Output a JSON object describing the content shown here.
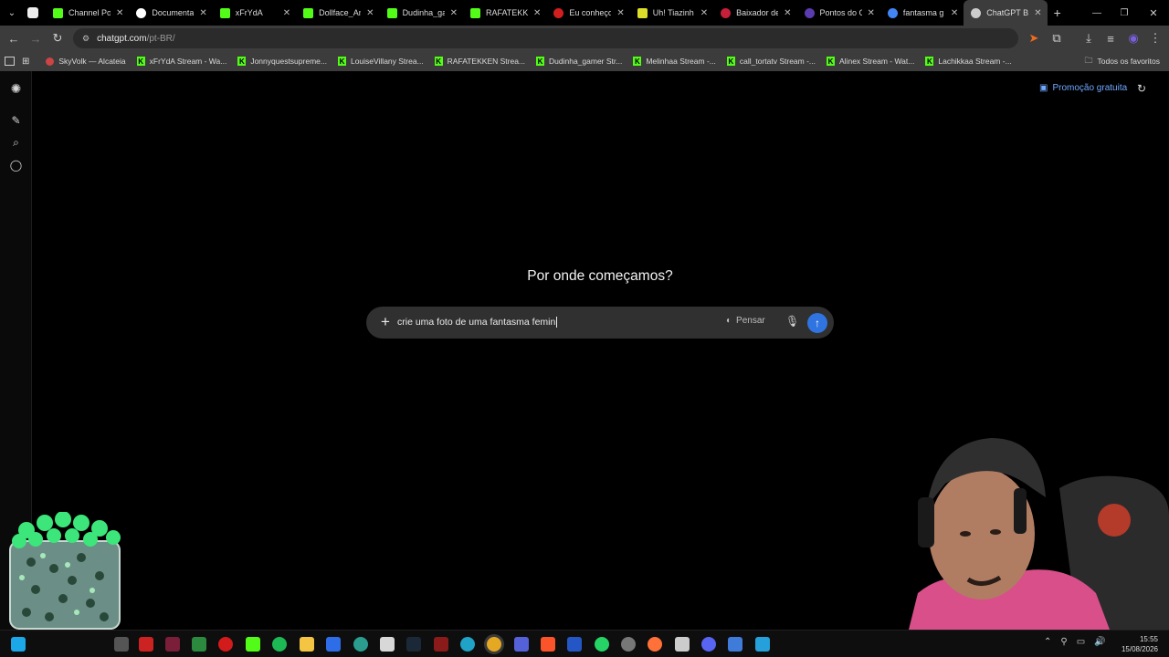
{
  "browser": {
    "tabs": [
      {
        "title": "Channel Po",
        "icon": "kick-icon",
        "color": "#53fc18",
        "active": false
      },
      {
        "title": "Documenta",
        "icon": "github-icon",
        "color": "#ffffff",
        "active": false
      },
      {
        "title": "xFrYdA",
        "icon": "kick-icon",
        "color": "#53fc18",
        "active": false
      },
      {
        "title": "Dollface_An",
        "icon": "kick-icon",
        "color": "#53fc18",
        "active": false
      },
      {
        "title": "Dudinha_ga",
        "icon": "kick-icon",
        "color": "#53fc18",
        "active": false
      },
      {
        "title": "RAFATEKKE",
        "icon": "kick-icon",
        "color": "#53fc18",
        "active": false
      },
      {
        "title": "Eu conheço",
        "icon": "red-circle-icon",
        "color": "#d11f1f",
        "active": false
      },
      {
        "title": "Uh! Tiazinh",
        "icon": "yellow-square-icon",
        "color": "#dede2a",
        "active": false
      },
      {
        "title": "Baixador de",
        "icon": "red-circle-icon",
        "color": "#c51f3a",
        "active": false
      },
      {
        "title": "Pontos do C",
        "icon": "purple-circle-icon",
        "color": "#5b3bb0",
        "active": false
      },
      {
        "title": "fantasma g",
        "icon": "google-icon",
        "color": "#4285f4",
        "active": false
      },
      {
        "title": "ChatGPT Br",
        "icon": "chatgpt-icon",
        "color": "#cccccc",
        "active": true
      }
    ],
    "address": {
      "host": "chatgpt.com",
      "path": "/pt-BR/"
    },
    "bookmarks": [
      {
        "label": "SkyVolk — Alcateia",
        "icon": "wolf-icon"
      },
      {
        "label": "xFrYdA Stream - Wa...",
        "icon": "kick-icon"
      },
      {
        "label": "Jonnyquestsupreme...",
        "icon": "kick-icon"
      },
      {
        "label": "LouiseVillany Strea...",
        "icon": "kick-icon"
      },
      {
        "label": "RAFATEKKEN Strea...",
        "icon": "kick-icon"
      },
      {
        "label": "Dudinha_gamer Str...",
        "icon": "kick-icon"
      },
      {
        "label": "Melinhaa Stream -...",
        "icon": "kick-icon"
      },
      {
        "label": "call_tortatv Stream -...",
        "icon": "kick-icon"
      },
      {
        "label": "Alinex Stream - Wat...",
        "icon": "kick-icon"
      },
      {
        "label": "Lachikkaa Stream -...",
        "icon": "kick-icon"
      }
    ],
    "all_bookmarks_label": "Todos os favoritos"
  },
  "chatgpt": {
    "promo_label": "Promoção gratuita",
    "headline": "Por onde começamos?",
    "prompt_text": "crie uma foto de uma fantasma femin",
    "think_label": "Pensar"
  },
  "taskbar": {
    "time": "15:55",
    "date": "15/08/2026"
  },
  "colors": {
    "accent_blue": "#2f74e0",
    "kick_green": "#53fc18",
    "promo_blue": "#6fa8ff"
  }
}
